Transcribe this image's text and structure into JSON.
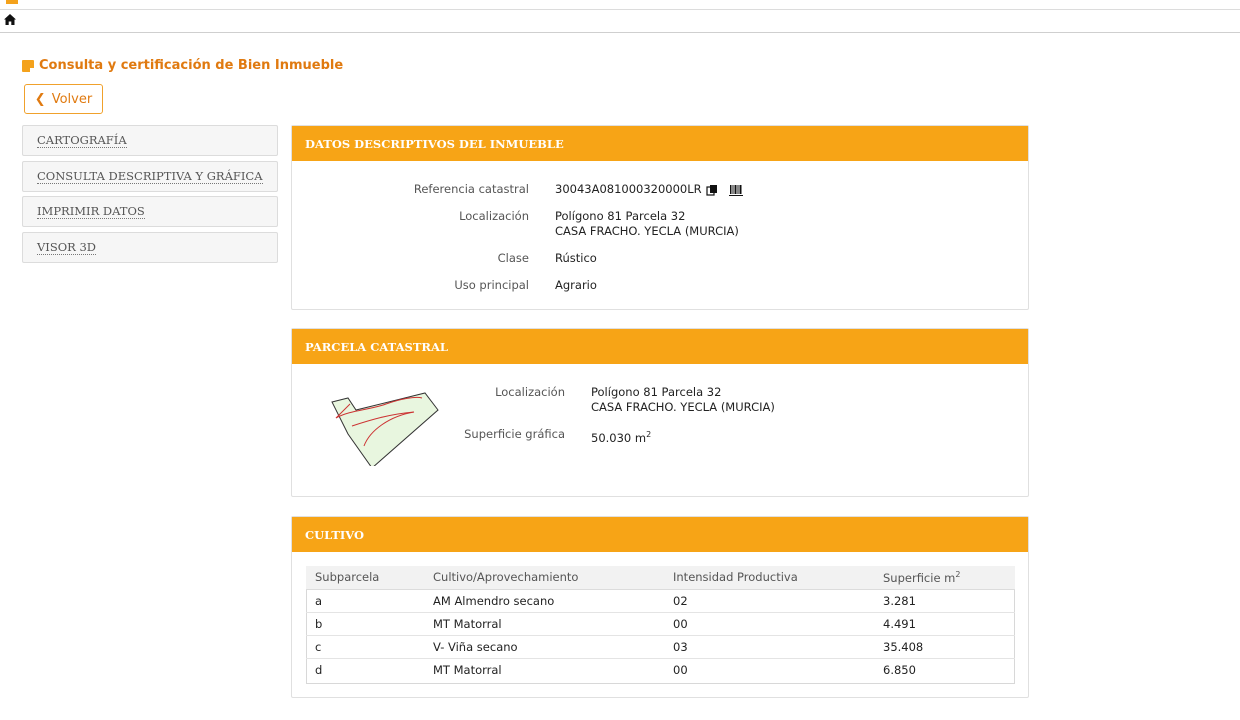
{
  "header": {
    "home_icon": "home-icon"
  },
  "page": {
    "title": "Consulta y certificación de Bien Inmueble",
    "back_label": "Volver"
  },
  "sidebar": {
    "items": [
      {
        "label": "CARTOGRAFÍA"
      },
      {
        "label": "CONSULTA DESCRIPTIVA Y GRÁFICA"
      },
      {
        "label": "IMPRIMIR DATOS"
      },
      {
        "label": "VISOR 3D"
      }
    ]
  },
  "datos": {
    "header": "DATOS DESCRIPTIVOS DEL INMUEBLE",
    "ref_label": "Referencia catastral",
    "ref_value": "30043A081000320000LR",
    "loc_label": "Localización",
    "loc_line1": "Polígono 81 Parcela 32",
    "loc_line2": "CASA FRACHO. YECLA (MURCIA)",
    "clase_label": "Clase",
    "clase_value": "Rústico",
    "uso_label": "Uso principal",
    "uso_value": "Agrario"
  },
  "parcela": {
    "header": "PARCELA CATASTRAL",
    "loc_label": "Localización",
    "loc_line1": "Polígono 81 Parcela 32",
    "loc_line2": "CASA FRACHO. YECLA (MURCIA)",
    "sup_label": "Superficie gráfica",
    "sup_value": "50.030 m",
    "sup_exp": "2",
    "colors": {
      "fill": "#e8f6df",
      "outline": "#333333",
      "subdivision": "#cc3333"
    }
  },
  "cultivo": {
    "header": "CULTIVO",
    "columns": [
      "Subparcela",
      "Cultivo/Aprovechamiento",
      "Intensidad Productiva",
      "Superficie m"
    ],
    "sup_exp": "2",
    "rows": [
      [
        "a",
        "AM Almendro secano",
        "02",
        "3.281"
      ],
      [
        "b",
        "MT Matorral",
        "00",
        "4.491"
      ],
      [
        "c",
        "V- Viña secano",
        "03",
        "35.408"
      ],
      [
        "d",
        "MT Matorral",
        "00",
        "6.850"
      ]
    ]
  },
  "colors": {
    "accent": "#f7a416",
    "title": "#e07a10"
  }
}
